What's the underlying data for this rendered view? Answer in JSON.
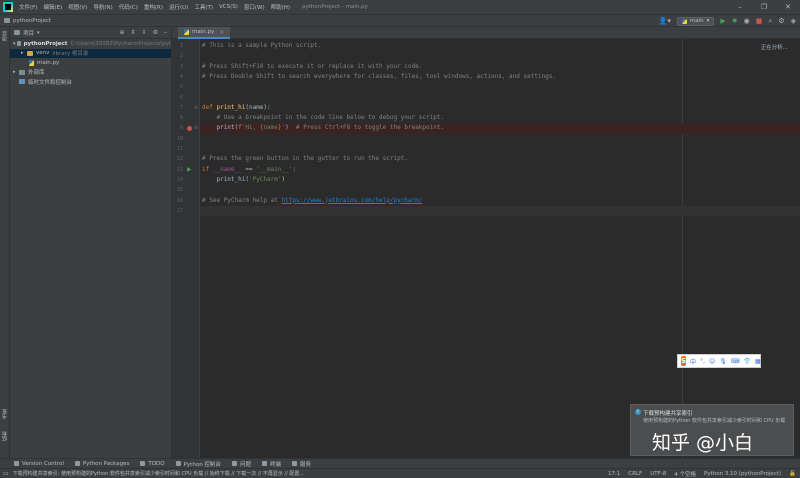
{
  "titlebar": {
    "menu": [
      "文件(F)",
      "编辑(E)",
      "视图(V)",
      "导航(N)",
      "代码(C)",
      "重构(R)",
      "运行(U)",
      "工具(T)",
      "VCS(S)",
      "窗口(W)",
      "帮助(H)"
    ],
    "window_title": "pythonProject - main.py"
  },
  "navbar": {
    "project": "pythonProject",
    "run_config": "main"
  },
  "left_strip": {
    "top_tab": "项目",
    "bottom_tabs": [
      "书签",
      "结构"
    ]
  },
  "project_panel": {
    "header": "项目",
    "tree": [
      {
        "label": "pythonProject",
        "hint": "C:\\Users\\39182\\PycharmProjects\\pyt"
      },
      {
        "label": "venv",
        "hint": "library 根目录"
      },
      {
        "label": "main.py",
        "hint": ""
      },
      {
        "label": "外部库",
        "hint": ""
      },
      {
        "label": "临时文件和控制台",
        "hint": ""
      }
    ]
  },
  "editor": {
    "tab_label": "main.py",
    "analysis_status": "正在分析...",
    "line_numbers": [
      "1",
      "2",
      "3",
      "4",
      "5",
      "6",
      "7",
      "8",
      "9",
      "10",
      "11",
      "12",
      "13",
      "14",
      "15",
      "16",
      "17"
    ],
    "lines": [
      "# This is a sample Python script.",
      "",
      "# Press Shift+F10 to execute it or replace it with your code.",
      "# Press Double Shift to search everywhere for classes, files, tool windows, actions, and settings.",
      "",
      "",
      "def print_hi(name):",
      "    # Use a breakpoint in the code line below to debug your script.",
      "    print(f'Hi, {name}')  # Press Ctrl+F8 to toggle the breakpoint.",
      "",
      "",
      "# Press the green button in the gutter to run the script.",
      "if __name__ == '__main__':",
      "    print_hi('PyCharm')",
      "",
      "# See PyCharm help at https://www.jetbrains.com/help/pycharm/",
      ""
    ]
  },
  "ime": {
    "logo": "S",
    "items": [
      "中",
      "°,",
      "☺",
      "🎙",
      "⌨",
      "👕",
      "▦"
    ]
  },
  "notification": {
    "title": "下载预构建共享索引",
    "body": "使用预构建的Python 软件包共享索引减少索引时间和 CPU 负载"
  },
  "watermark": "知乎 @小白",
  "bottom_tools": [
    "Version Control",
    "Python Packages",
    "TODO",
    "Python 控制台",
    "问题",
    "终端",
    "服务"
  ],
  "statusbar": {
    "message": "下载预构建共享索引: 使用预构建的Python 软件包共享索引减少索引时间和 CPU 负载 // 始终下载 // 下载一次 // 不再显示 // 配置...",
    "position": "17:1",
    "line_sep": "CRLF",
    "encoding": "UTF-8",
    "indent": "4 个空格",
    "interpreter": "Python 3.10 (pythonProject)"
  },
  "colors": {
    "keyword": "#cc7832",
    "function": "#ffc66d",
    "string": "#6a8759",
    "comment": "#808080",
    "link": "#287bde",
    "breakpoint": "#c75450",
    "run": "#499c54"
  }
}
